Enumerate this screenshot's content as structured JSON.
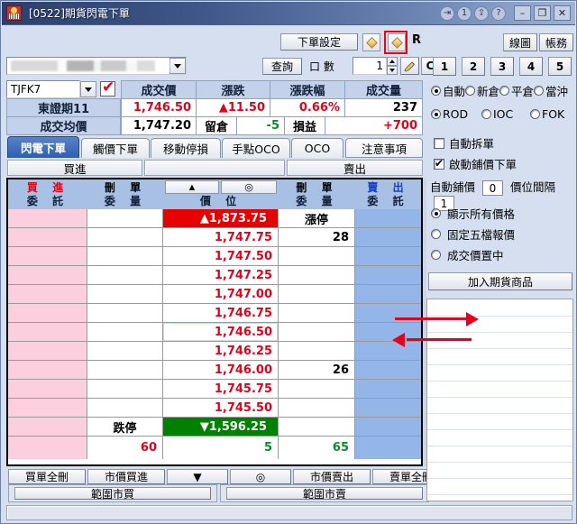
{
  "window": {
    "title": "[0522]期貨閃電下單",
    "icon": "futures-app-icon",
    "controls": {
      "export": "⇥",
      "count": "1",
      "popout": "⇪",
      "help": "?",
      "minimize": "–",
      "maximize": "❐",
      "close": "✕"
    }
  },
  "toolbar": {
    "order_setting": "下單設定",
    "diamond_1": "diamond-icon",
    "diamond_2": "diamond-icon-selected",
    "r_label": "R",
    "line_chart": "線圖",
    "account": "帳務"
  },
  "account_row": {
    "account_value": "",
    "account_masked": true,
    "query": "查詢",
    "qty_label": "口 數",
    "qty_value": "1",
    "pen_icon": "pen-icon",
    "clear_label": "C"
  },
  "numpad": [
    "1",
    "2",
    "3",
    "4",
    "5"
  ],
  "symbol": {
    "code": "TJFK7",
    "checked": true,
    "name": "東證期11"
  },
  "quote": {
    "headers": [
      "成交價",
      "漲跌",
      "漲跌幅",
      "成交量"
    ],
    "values": [
      "1,746.50",
      "▲11.50",
      "0.66%",
      "237"
    ],
    "avg_label": "成交均價",
    "avg_value": "1,747.20",
    "hold_label": "留倉",
    "hold_value": "-5",
    "pnl_label": "損益",
    "pnl_value": "+700"
  },
  "tabs": [
    {
      "label": "閃電下單",
      "active": true
    },
    {
      "label": "觸價下單",
      "active": false
    },
    {
      "label": "移動停損",
      "active": false
    },
    {
      "label": "手點OCO",
      "active": false
    },
    {
      "label": "OCO",
      "active": false
    },
    {
      "label": "注意事項",
      "active": false,
      "note": true
    }
  ],
  "bs_bars": {
    "buy": "買進",
    "middle": "",
    "sell": "賣出"
  },
  "ladder": {
    "headers": {
      "buy_order_1": "買 進",
      "buy_order_2": "委 託",
      "cancel_buy_1": "刪 單",
      "cancel_buy_2": "委 量",
      "price_btn_up": "▲",
      "price_btn_center": "◎",
      "price_label": "價 位",
      "cancel_sell_1": "刪 單",
      "cancel_sell_2": "委 量",
      "sell_order_1": "賣 出",
      "sell_order_2": "委 託"
    },
    "rows": [
      {
        "buy_order": "",
        "cancel_buy": "",
        "price": "▲1,873.75",
        "cancel_sell": "漲停",
        "sell_order": "",
        "type": "limit-up"
      },
      {
        "buy_order": "",
        "cancel_buy": "",
        "price": "1,747.75",
        "cancel_sell": "28",
        "sell_order": "",
        "type": "normal"
      },
      {
        "buy_order": "",
        "cancel_buy": "",
        "price": "1,747.50",
        "cancel_sell": "",
        "sell_order": "",
        "type": "normal"
      },
      {
        "buy_order": "",
        "cancel_buy": "",
        "price": "1,747.25",
        "cancel_sell": "",
        "sell_order": "",
        "type": "normal"
      },
      {
        "buy_order": "",
        "cancel_buy": "",
        "price": "1,747.00",
        "cancel_sell": "",
        "sell_order": "",
        "type": "normal"
      },
      {
        "buy_order": "",
        "cancel_buy": "",
        "price": "1,746.75",
        "cancel_sell": "",
        "sell_order": "",
        "type": "normal"
      },
      {
        "buy_order": "",
        "cancel_buy": "",
        "price": "1,746.50",
        "cancel_sell": "",
        "sell_order": "",
        "type": "highlight"
      },
      {
        "buy_order": "",
        "cancel_buy": "",
        "price": "1,746.25",
        "cancel_sell": "",
        "sell_order": "",
        "type": "normal"
      },
      {
        "buy_order": "",
        "cancel_buy": "",
        "price": "1,746.00",
        "cancel_sell": "26",
        "sell_order": "",
        "type": "normal"
      },
      {
        "buy_order": "",
        "cancel_buy": "",
        "price": "1,745.75",
        "cancel_sell": "",
        "sell_order": "",
        "type": "normal"
      },
      {
        "buy_order": "",
        "cancel_buy": "",
        "price": "1,745.50",
        "cancel_sell": "",
        "sell_order": "",
        "type": "normal"
      },
      {
        "buy_order": "",
        "cancel_buy": "跌停",
        "price": "▼1,596.25",
        "cancel_sell": "",
        "sell_order": "",
        "type": "limit-down"
      },
      {
        "buy_order": "",
        "cancel_buy": "60",
        "price": "5",
        "cancel_sell": "65",
        "sell_order": "",
        "type": "totals"
      }
    ]
  },
  "bottom_buttons": {
    "cancel_all_buy": "買單全刪",
    "market_buy": "市價買進",
    "down_arrow": "▼",
    "center": "◎",
    "market_sell": "市價賣出",
    "cancel_all_sell": "賣單全刪",
    "range_buy": "範圍市買",
    "range_sell": "範圍市賣"
  },
  "options": {
    "trade_type": {
      "items": [
        "自動",
        "新倉",
        "平倉",
        "當沖"
      ],
      "selected": "自動"
    },
    "order_type": {
      "items": [
        "ROD",
        "IOC",
        "FOK"
      ],
      "selected": "ROD"
    },
    "auto_split": {
      "label": "自動拆單",
      "checked": false
    },
    "enable_chase": {
      "label": "啟動鋪價下單",
      "checked": true
    },
    "auto_chase_label": "自動鋪價",
    "auto_chase_value": "0",
    "tick_gap_label": "價位間隔",
    "tick_gap_value": "1",
    "display_mode": {
      "items": [
        "顯示所有價格",
        "固定五檔報價",
        "成交價置中"
      ],
      "selected": "顯示所有價格"
    },
    "add_product": "加入期貨商品"
  },
  "colors": {
    "up_red": "#e2001a",
    "down_green": "#008000",
    "limit_up_bg": "#e60000",
    "limit_down_bg": "#008000",
    "buy_col_bg": "#fbcfdd",
    "sell_col_bg": "#93b5e8",
    "header_bg": "#a8c0e4",
    "panel_bg": "#d6dff0",
    "annotation_red": "#e2001a"
  }
}
